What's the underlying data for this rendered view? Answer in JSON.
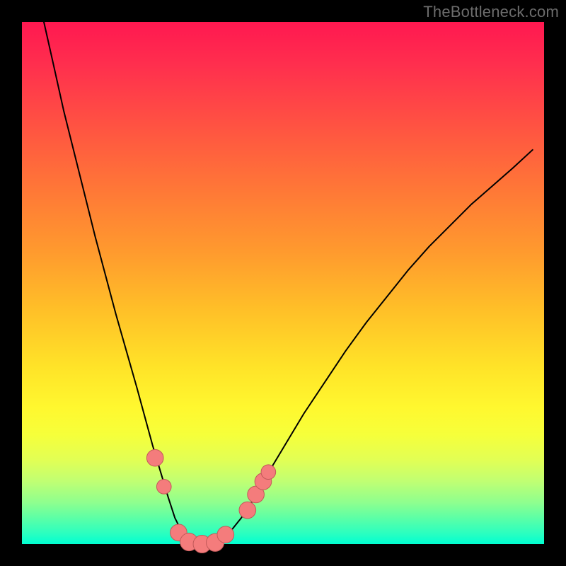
{
  "watermark": "TheBottleneck.com",
  "chart_data": {
    "type": "line",
    "title": "",
    "xlabel": "",
    "ylabel": "",
    "xlim": [
      0,
      100
    ],
    "ylim": [
      0,
      100
    ],
    "background_gradient": {
      "orientation": "vertical",
      "stops": [
        {
          "pos": 0,
          "color": "#ff1850"
        },
        {
          "pos": 8,
          "color": "#ff2e4e"
        },
        {
          "pos": 22,
          "color": "#ff5940"
        },
        {
          "pos": 33,
          "color": "#ff7a36"
        },
        {
          "pos": 44,
          "color": "#ff9a2e"
        },
        {
          "pos": 55,
          "color": "#ffbf28"
        },
        {
          "pos": 66,
          "color": "#ffe328"
        },
        {
          "pos": 74,
          "color": "#fff82f"
        },
        {
          "pos": 79,
          "color": "#f6ff3a"
        },
        {
          "pos": 84,
          "color": "#e1ff55"
        },
        {
          "pos": 88,
          "color": "#c0ff73"
        },
        {
          "pos": 92,
          "color": "#8fff8e"
        },
        {
          "pos": 95,
          "color": "#5cffa6"
        },
        {
          "pos": 98,
          "color": "#2affc0"
        },
        {
          "pos": 100,
          "color": "#00ffd2"
        }
      ]
    },
    "series": [
      {
        "name": "bottleneck-curve",
        "stroke": "#000000",
        "stroke_width": 2,
        "x": [
          4.2,
          6,
          8,
          10,
          12,
          14,
          16,
          18,
          20,
          22,
          23.5,
          25,
          26.5,
          28,
          29.3,
          30.8,
          32,
          34,
          36,
          38,
          40,
          42,
          44,
          46,
          48,
          51,
          54,
          58,
          62,
          66,
          70,
          74,
          78,
          82,
          86,
          90,
          94,
          97.8
        ],
        "y": [
          100,
          92,
          83,
          75,
          67,
          59,
          51.5,
          44,
          37,
          30,
          24.5,
          19,
          14,
          9,
          5,
          2,
          0.5,
          0,
          0,
          0.8,
          2.5,
          5,
          8,
          11.5,
          15,
          20,
          25,
          31,
          37,
          42.5,
          47.5,
          52.5,
          57,
          61,
          65,
          68.5,
          72,
          75.5
        ]
      }
    ],
    "markers": [
      {
        "x": 25.5,
        "y": 16.5,
        "r": 1.6,
        "color": "#f47c7c"
      },
      {
        "x": 27.2,
        "y": 11.0,
        "r": 1.4,
        "color": "#f47c7c"
      },
      {
        "x": 30.0,
        "y": 2.2,
        "r": 1.6,
        "color": "#f47c7c"
      },
      {
        "x": 32.0,
        "y": 0.4,
        "r": 1.7,
        "color": "#f47c7c"
      },
      {
        "x": 34.5,
        "y": 0.0,
        "r": 1.7,
        "color": "#f47c7c"
      },
      {
        "x": 37.0,
        "y": 0.3,
        "r": 1.7,
        "color": "#f47c7c"
      },
      {
        "x": 39.0,
        "y": 1.8,
        "r": 1.6,
        "color": "#f47c7c"
      },
      {
        "x": 43.2,
        "y": 6.5,
        "r": 1.6,
        "color": "#f47c7c"
      },
      {
        "x": 44.8,
        "y": 9.5,
        "r": 1.6,
        "color": "#f47c7c"
      },
      {
        "x": 46.2,
        "y": 12.0,
        "r": 1.6,
        "color": "#f47c7c"
      },
      {
        "x": 47.2,
        "y": 13.8,
        "r": 1.4,
        "color": "#f47c7c"
      }
    ]
  }
}
